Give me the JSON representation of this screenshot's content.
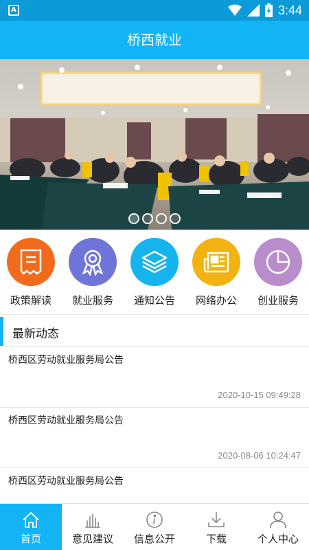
{
  "status_bar": {
    "app_icon": "A",
    "time": "3:44"
  },
  "header": {
    "title": "桥西就业"
  },
  "banner": {
    "image": "conference-meeting-photo",
    "slide_count": 4,
    "active_slide": 1
  },
  "quick_menu": [
    {
      "label": "政策解读",
      "icon": "document-icon",
      "color": "#f26b1d"
    },
    {
      "label": "就业服务",
      "icon": "award-ribbon-icon",
      "color": "#6f74d8"
    },
    {
      "label": "通知公告",
      "icon": "layers-icon",
      "color": "#16b4ee"
    },
    {
      "label": "网络办公",
      "icon": "newspaper-icon",
      "color": "#f2b312"
    },
    {
      "label": "创业服务",
      "icon": "pie-chart-icon",
      "color": "#b98ccc"
    }
  ],
  "news_section": {
    "title": "最新动态",
    "items": [
      {
        "title": "桥西区劳动就业服务局公告",
        "date": "2020-10-15 09:49:28"
      },
      {
        "title": "桥西区劳动就业服务局公告",
        "date": "2020-08-06 10:24:47"
      },
      {
        "title": "桥西区劳动就业服务局公告",
        "date": ""
      }
    ]
  },
  "bottom_nav": [
    {
      "label": "首页",
      "icon": "home-icon",
      "active": true
    },
    {
      "label": "意见建议",
      "icon": "bar-chart-icon",
      "active": false
    },
    {
      "label": "信息公开",
      "icon": "info-icon",
      "active": false
    },
    {
      "label": "下载",
      "icon": "download-icon",
      "active": false
    },
    {
      "label": "个人中心",
      "icon": "user-icon",
      "active": false
    }
  ]
}
